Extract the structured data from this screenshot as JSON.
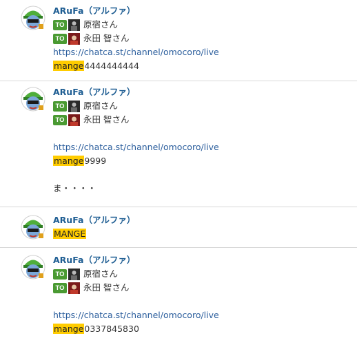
{
  "messages": [
    {
      "sender": "ARuFa（アルファ）",
      "to": [
        "原宿さん",
        "永田 智さん"
      ],
      "link": "https://chatca.st/channel/omocoro/live",
      "mention": "mange",
      "rest": "4444444444"
    },
    {
      "sender": "ARuFa（アルファ）",
      "to": [
        "原宿さん",
        "永田 智さん"
      ],
      "link": "https://chatca.st/channel/omocoro/live",
      "mention": "mange",
      "rest": "9999",
      "extra": "ま・・・・"
    },
    {
      "sender": "ARuFa（アルファ）",
      "mention": "MANGE"
    },
    {
      "sender": "ARuFa（アルファ）",
      "to": [
        "原宿さん",
        "永田 智さん"
      ],
      "link": "https://chatca.st/channel/omocoro/live",
      "mention": "mange",
      "rest": "0337845830"
    }
  ],
  "to_label": "TO",
  "colors": {
    "sender": "#1f5e93",
    "link": "#2a5d9c",
    "mention_highlight": "#ffcc00",
    "to_badge": "#4a9a32"
  },
  "icons": {
    "avatar": "green-cap-character-avatar-icon",
    "to_avatar_1": "harajuku-avatar-icon",
    "to_avatar_2": "nagata-avatar-icon"
  }
}
